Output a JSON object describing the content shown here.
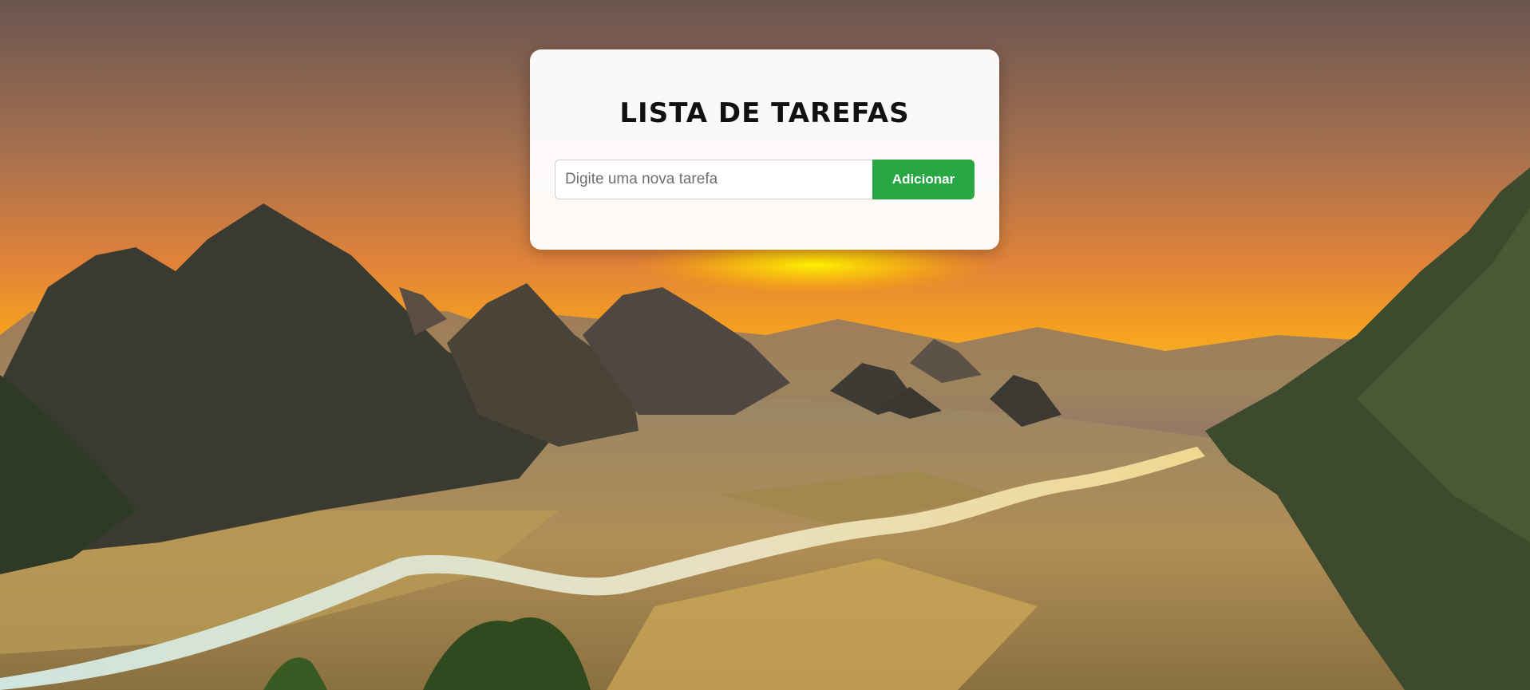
{
  "app": {
    "title": "LISTA DE TAREFAS"
  },
  "form": {
    "input_value": "",
    "input_placeholder": "Digite uma nova tarefa",
    "add_label": "Adicionar"
  },
  "colors": {
    "accent_button": "#28a745",
    "card_background": "#ffffff"
  },
  "background": {
    "image": "sunset-karst-mountain-valley-landscape"
  }
}
